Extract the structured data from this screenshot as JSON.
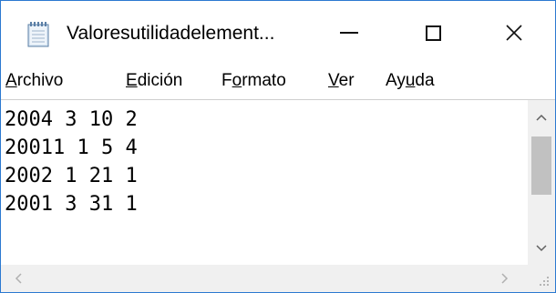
{
  "window": {
    "title": "Valoresutilidadelement...",
    "minimize_icon": "minimize-icon",
    "maximize_icon": "maximize-icon",
    "close_icon": "close-icon"
  },
  "menu": {
    "items": [
      {
        "pre": "",
        "acc": "A",
        "post": "rchivo"
      },
      {
        "pre": "",
        "acc": "E",
        "post": "dición"
      },
      {
        "pre": "F",
        "acc": "o",
        "post": "rmato"
      },
      {
        "pre": "",
        "acc": "V",
        "post": "er"
      },
      {
        "pre": "Ay",
        "acc": "u",
        "post": "da"
      }
    ]
  },
  "editor": {
    "lines": [
      "2004 3 10 2",
      "20011 1 5 4",
      "2002 1 21 1",
      "2001 3 31 1"
    ]
  },
  "colors": {
    "window_border": "#2b79d1",
    "scrollbar_track": "#f0f0f0",
    "scrollbar_thumb": "#c1c1c1"
  }
}
